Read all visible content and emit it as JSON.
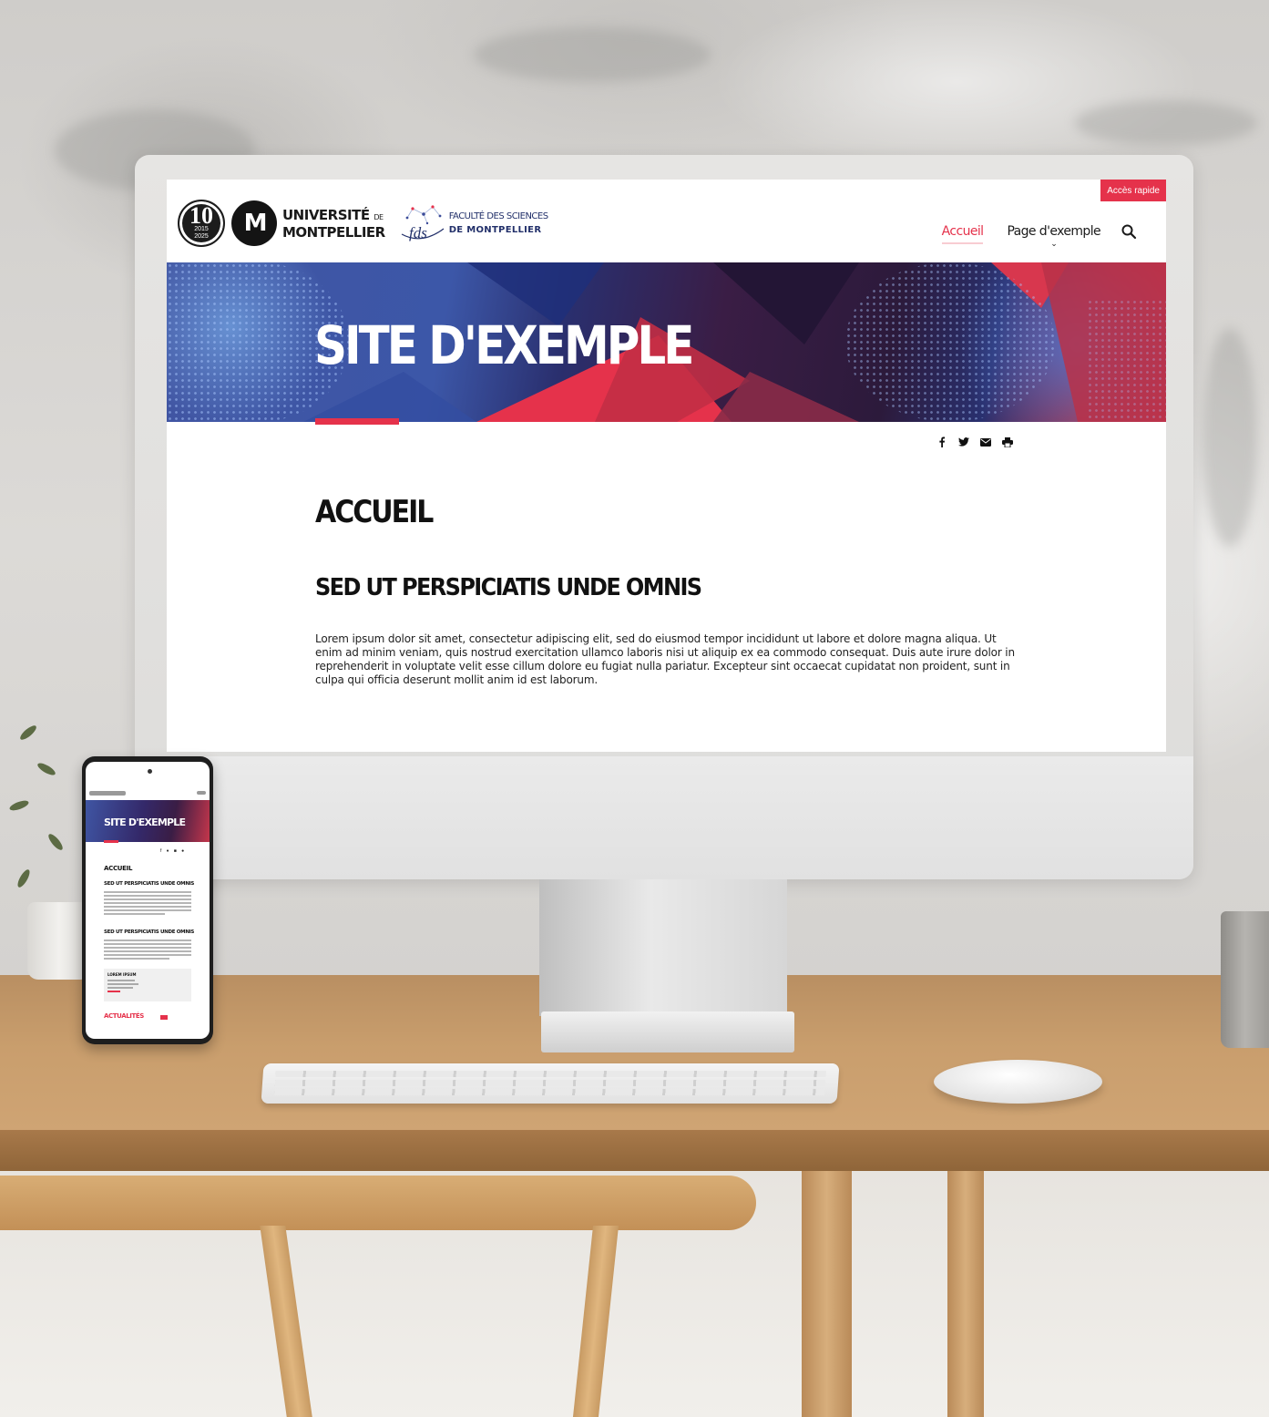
{
  "site": {
    "quick_access": "Accès rapide",
    "badge_number": "10",
    "badge_years": "2015\n2025",
    "univ_line1": "UNIVERSITÉ",
    "univ_line1_small": "DE",
    "univ_line2": "MONTPELLIER",
    "fds_mark": "fds",
    "fds_line1": "FACULTÉ DES SCIENCES",
    "fds_line2": "DE MONTPELLIER",
    "nav": {
      "home": "Accueil",
      "example_page": "Page d'exemple"
    },
    "banner_title": "SITE D'EXEMPLE",
    "page_title": "ACCUEIL",
    "section_title": "SED UT PERSPICIATIS UNDE OMNIS",
    "body": "Lorem ipsum dolor sit amet, consectetur adipiscing elit, sed do eiusmod tempor incididunt ut labore et dolore magna aliqua. Ut enim ad minim veniam, quis nostrud exercitation ullamco laboris nisi ut aliquip ex ea commodo consequat. Duis aute irure dolor in reprehenderit in voluptate velit esse cillum dolore eu fugiat nulla pariatur. Excepteur sint occaecat cupidatat non proident, sunt in culpa qui officia deserunt mollit anim id est laborum.",
    "share_icons": [
      "facebook-icon",
      "twitter-icon",
      "email-icon",
      "print-icon"
    ]
  },
  "phone": {
    "banner_title": "SITE D'EXEMPLE",
    "page_title": "ACCUEIL",
    "section_title_1": "SED UT PERSPICIATIS UNDE OMNIS",
    "section_title_2": "SED UT PERSPICIATIS UNDE OMNIS",
    "box_title": "LOREM IPSUM",
    "news_title": "ACTUALITÉS"
  },
  "colors": {
    "accent": "#e5324b",
    "banner_blue": "#3c57a8",
    "banner_dark": "#2c1a3b",
    "text": "#111111"
  }
}
